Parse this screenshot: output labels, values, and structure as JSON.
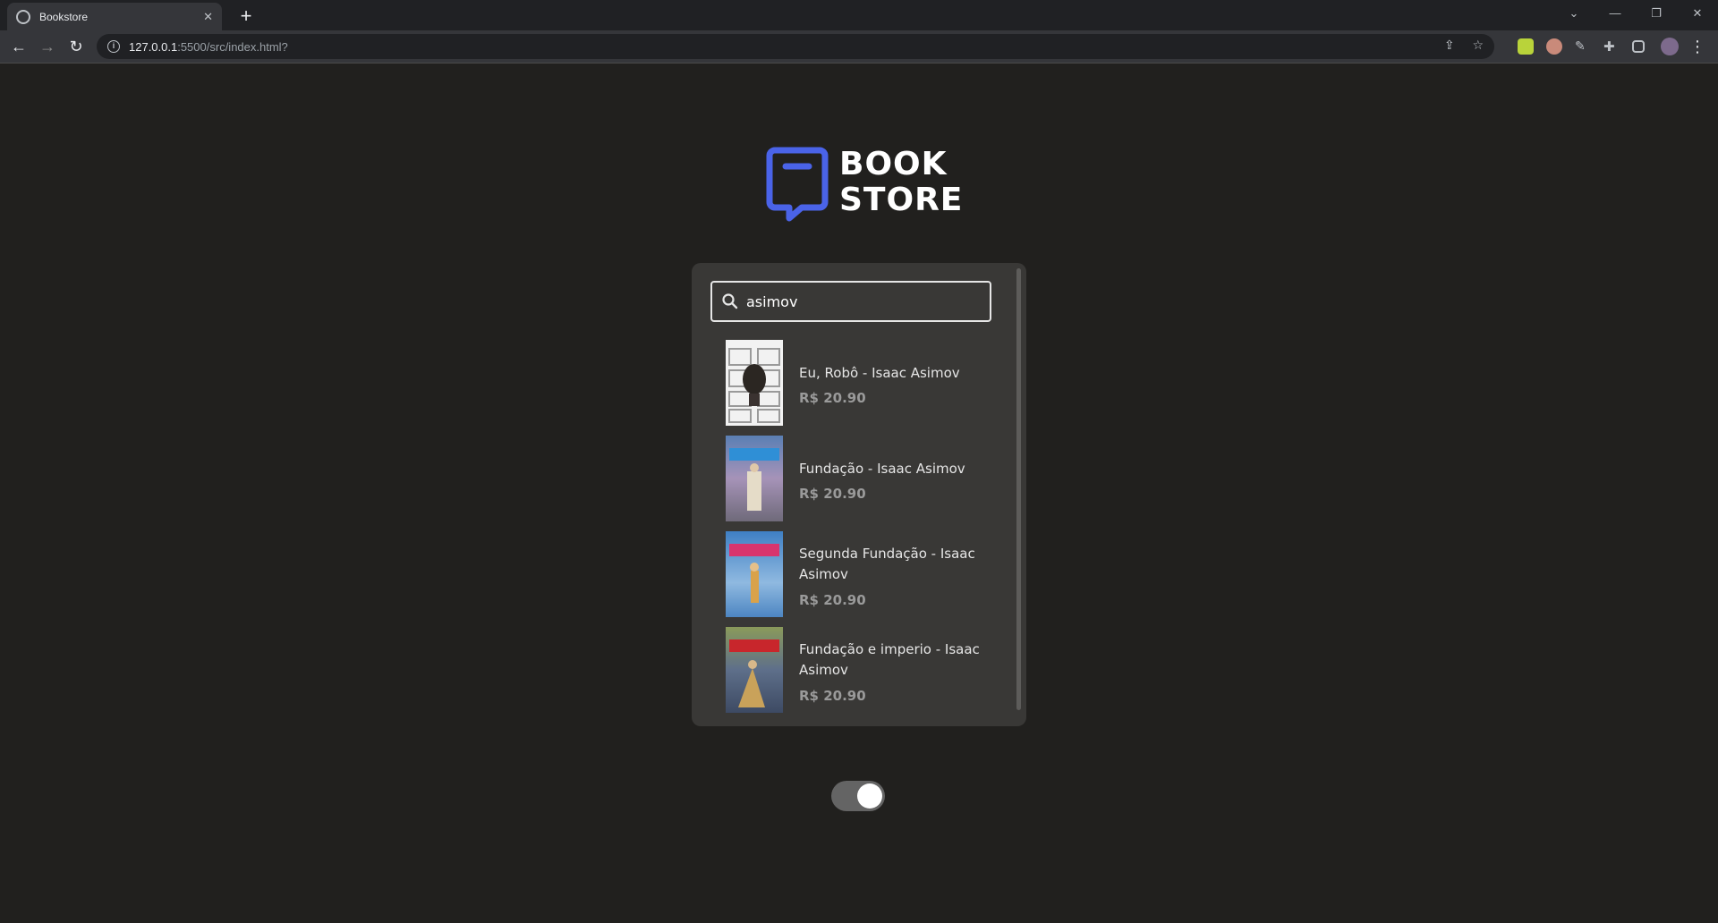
{
  "browser": {
    "tab_title": "Bookstore",
    "url_host": "127.0.0.1",
    "url_rest": ":5500/src/index.html?"
  },
  "logo": {
    "line1": "BOOK",
    "line2": "STORE",
    "color": "#4a63e8"
  },
  "search": {
    "value": "asimov"
  },
  "books": [
    {
      "title": "Eu, Robô - Isaac Asimov",
      "price": "R$ 20.90"
    },
    {
      "title": "Fundação - Isaac Asimov",
      "price": "R$ 20.90"
    },
    {
      "title": "Segunda Fundação - Isaac Asimov",
      "price": "R$ 20.90"
    },
    {
      "title": "Fundação e imperio - Isaac Asimov",
      "price": "R$ 20.90"
    }
  ],
  "theme_toggle": {
    "on": true
  }
}
